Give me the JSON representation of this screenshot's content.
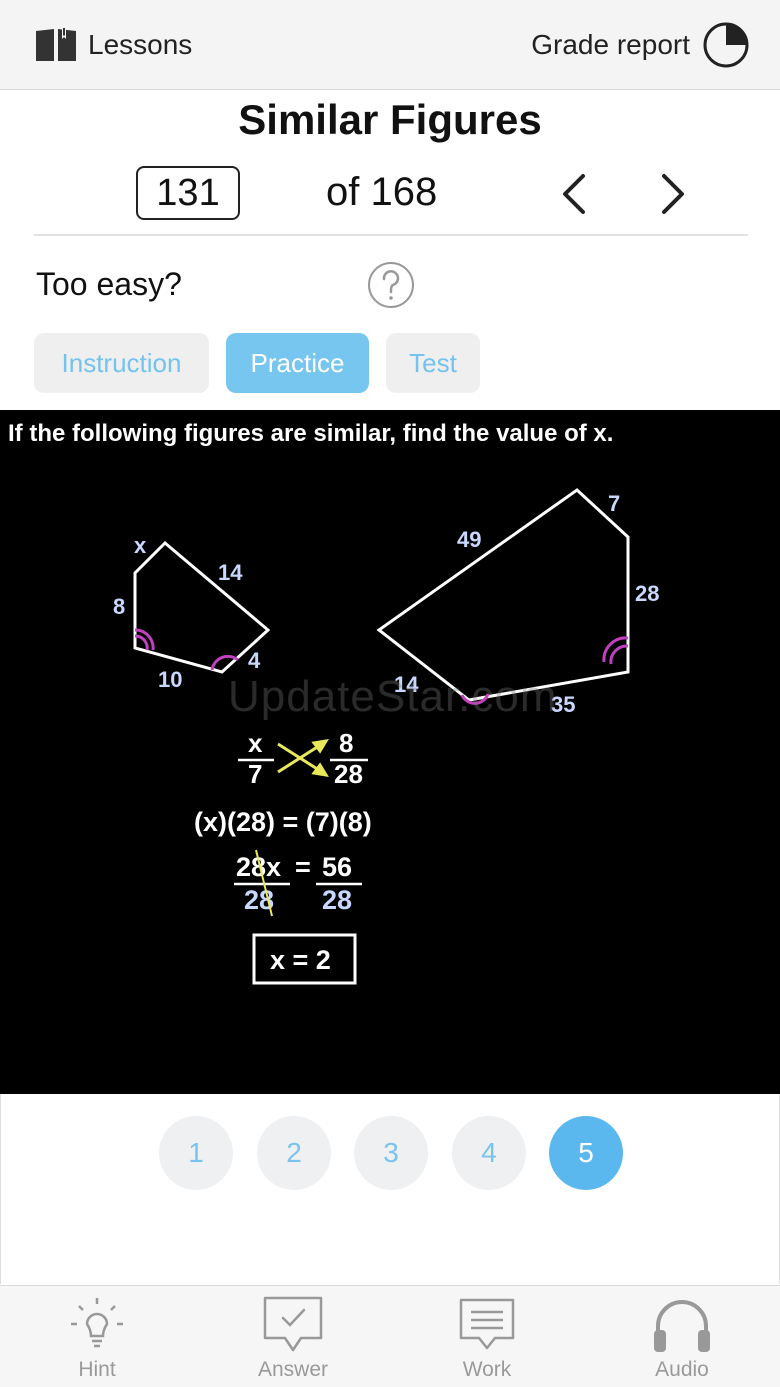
{
  "topbar": {
    "lessons_label": "Lessons",
    "grade_report_label": "Grade report",
    "lessons_icon": "book-icon",
    "grade_icon": "pie-chart-icon"
  },
  "lesson": {
    "title": "Similar Figures",
    "current_page": "131",
    "of_total": "of 168"
  },
  "difficulty": {
    "prompt": "Too easy?",
    "help_icon": "question-circle-icon"
  },
  "modes": {
    "instruction": "Instruction",
    "practice": "Practice",
    "test": "Test",
    "active": "Practice"
  },
  "problem": {
    "question": "If the following figures are similar, find the value of x.",
    "small_figure_labels": [
      "x",
      "14",
      "8",
      "4",
      "10"
    ],
    "large_figure_labels": [
      "7",
      "49",
      "28",
      "14",
      "35"
    ],
    "proportion": {
      "n1": "x",
      "d1": "7",
      "n2": "8",
      "d2": "28"
    },
    "cross_multiply": "(x)(28) = (7)(8)",
    "divide": {
      "n1": "28x",
      "d1": "28",
      "eq": "=",
      "n2": "56",
      "d2": "28"
    },
    "answer": "x = 2",
    "watermark": "UpdateStar.com"
  },
  "steps": {
    "items": [
      "1",
      "2",
      "3",
      "4",
      "5"
    ],
    "active": "5"
  },
  "toolbar": {
    "hint": "Hint",
    "answer": "Answer",
    "work": "Work",
    "audio": "Audio"
  },
  "colors": {
    "accent": "#5bb8ee",
    "tab_inactive_text": "#73c3ee",
    "angle_mark": "#c040c0",
    "arrow_yellow": "#e8e85a",
    "label_blue": "#c8d8ff"
  }
}
